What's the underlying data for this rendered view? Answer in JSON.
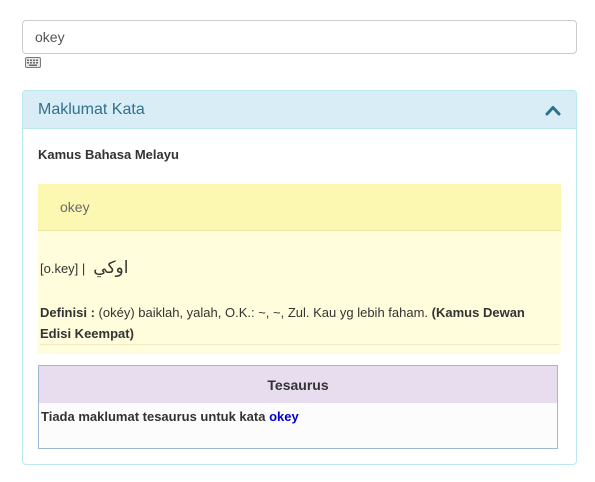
{
  "search": {
    "value": "okey"
  },
  "panel": {
    "title": "Maklumat Kata",
    "source_title": "Kamus Bahasa Melayu"
  },
  "entry": {
    "headword": "okey",
    "pronunciation": "[o.key] |",
    "jawi": "اوکي",
    "definition_label": "Definisi :",
    "definition_text": "(okéy) baiklah, yalah, O.K.: ~, ~, Zul. Kau yg lebih faham.",
    "definition_source": "(Kamus Dewan Edisi Keempat)"
  },
  "thesaurus": {
    "title": "Tesaurus",
    "message": "Tiada maklumat tesaurus untuk kata",
    "word": "okey"
  },
  "colors": {
    "panel_heading_bg": "#d9edf7",
    "panel_title": "#31708f",
    "entry_head_bg": "#fcf8b1",
    "entry_bg": "#fffddb",
    "thesaurus_head_bg": "#e8dcef",
    "link": "#0000cc"
  },
  "icons": {
    "keyboard": "keyboard-icon",
    "collapse": "chevron-up-icon"
  }
}
